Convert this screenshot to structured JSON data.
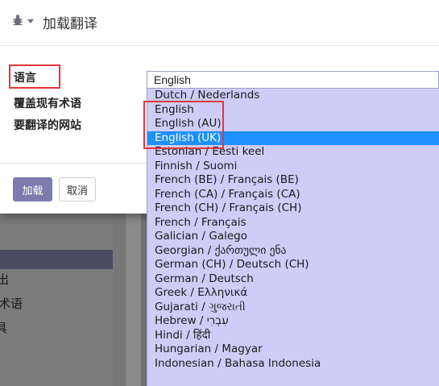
{
  "background": {
    "sidebar_items": [
      "",
      "出",
      "术语",
      "具"
    ]
  },
  "modal": {
    "title": "加载翻译",
    "labels": {
      "language": "语言",
      "overwrite_terms": "覆盖现有术语",
      "websites": "要翻译的网站"
    },
    "language_select": {
      "value": "English"
    },
    "buttons": {
      "load": "加载",
      "cancel": "取消"
    }
  },
  "dropdown": {
    "options": [
      "Dutch / Nederlands",
      "English",
      "English (AU)",
      "English (UK)",
      "Estonian / Eesti keel",
      "Finnish / Suomi",
      "French (BE) / Français (BE)",
      "French (CA) / Français (CA)",
      "French (CH) / Français (CH)",
      "French / Français",
      "Galician / Galego",
      "Georgian / ქართული ენა",
      "German (CH) / Deutsch (CH)",
      "German / Deutsch",
      "Greek / Ελληνικά",
      "Gujarati / ગુજરાતી",
      "Hebrew / עִבְרִי",
      "Hindi / हिंदी",
      "Hungarian / Magyar",
      "Indonesian / Bahasa Indonesia"
    ],
    "selected": "English (UK)"
  },
  "colors": {
    "highlight": "#e03838",
    "primary_button": "#7c7bad",
    "selected_option": "#1e90ff",
    "dropdown_bg": "#cdcdf8"
  }
}
